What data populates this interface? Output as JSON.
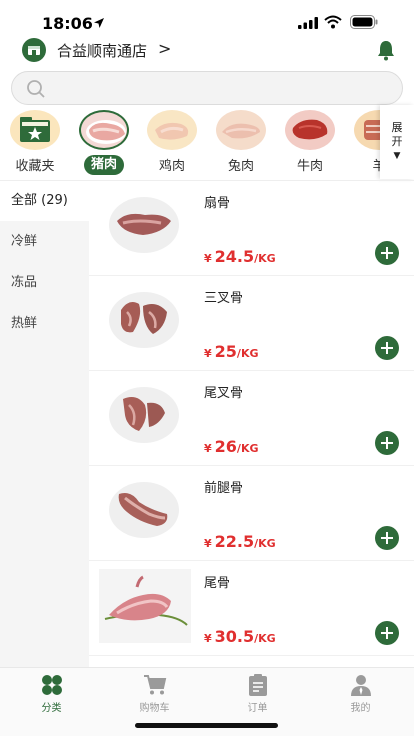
{
  "status_bar": {
    "time": "18:06"
  },
  "header": {
    "store_name": "合益顺南通店",
    "chevron": ">"
  },
  "search": {
    "placeholder": ""
  },
  "categories": [
    {
      "label": "收藏夹",
      "icon": "folder-star-icon",
      "selected": false
    },
    {
      "label": "猪肉",
      "icon": "pork-icon",
      "selected": true
    },
    {
      "label": "鸡肉",
      "icon": "chicken-icon",
      "selected": false
    },
    {
      "label": "兔肉",
      "icon": "rabbit-meat-icon",
      "selected": false
    },
    {
      "label": "牛肉",
      "icon": "beef-icon",
      "selected": false
    },
    {
      "label": "羊",
      "icon": "lamb-icon",
      "selected": false
    }
  ],
  "expand": {
    "label": "展开",
    "caret": "▼"
  },
  "sidebar": [
    {
      "label": "全部 (29)",
      "active": true
    },
    {
      "label": "冷鲜",
      "active": false
    },
    {
      "label": "冻品",
      "active": false
    },
    {
      "label": "热鲜",
      "active": false
    }
  ],
  "products": [
    {
      "name": "扇骨",
      "currency": "¥",
      "price": "24.5",
      "unit": "/KG"
    },
    {
      "name": "三叉骨",
      "currency": "¥",
      "price": "25",
      "unit": "/KG"
    },
    {
      "name": "尾叉骨",
      "currency": "¥",
      "price": "26",
      "unit": "/KG"
    },
    {
      "name": "前腿骨",
      "currency": "¥",
      "price": "22.5",
      "unit": "/KG"
    },
    {
      "name": "尾骨",
      "currency": "¥",
      "price": "30.5",
      "unit": "/KG"
    }
  ],
  "tabs": [
    {
      "label": "分类",
      "icon": "clover-icon",
      "active": true
    },
    {
      "label": "购物车",
      "icon": "cart-icon",
      "active": false
    },
    {
      "label": "订单",
      "icon": "clipboard-icon",
      "active": false
    },
    {
      "label": "我的",
      "icon": "user-icon",
      "active": false
    }
  ],
  "colors": {
    "brand_green": "#2e6b3a",
    "price_red": "#e02f2f"
  }
}
